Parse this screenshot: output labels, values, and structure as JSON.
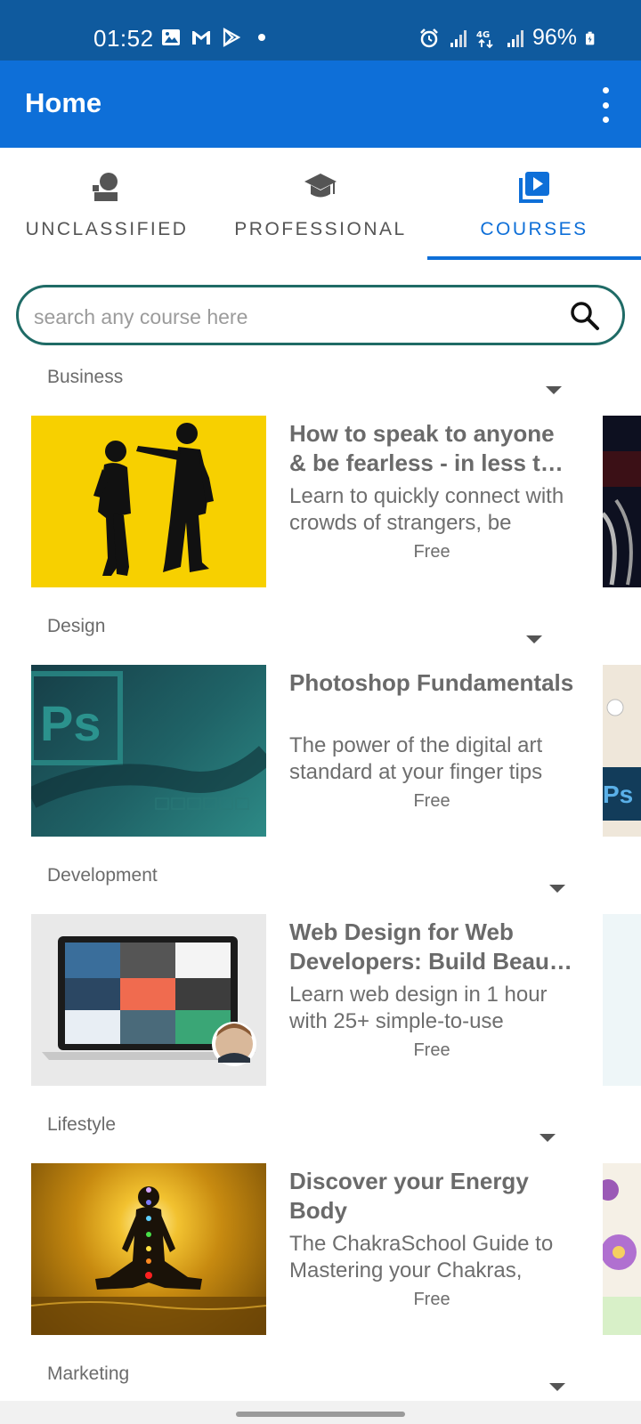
{
  "status_bar": {
    "time": "01:52",
    "battery": "96%",
    "left_icons": [
      "gallery-icon",
      "gmail-icon",
      "play-store-icon",
      "notification-dot"
    ],
    "right_icons": [
      "alarm-icon",
      "signal-icon",
      "4g-icon",
      "signal-icon",
      "battery-icon"
    ]
  },
  "app_bar": {
    "title": "Home",
    "menu_icon": "more-vert-icon",
    "color": "#0e6fd8"
  },
  "tabs": [
    {
      "label": "UNCLASSIFIED",
      "icon": "person-podium-icon",
      "active": false
    },
    {
      "label": "PROFESSIONAL",
      "icon": "graduation-cap-icon",
      "active": false
    },
    {
      "label": "COURSES",
      "icon": "video-library-icon",
      "active": true
    }
  ],
  "search": {
    "placeholder": "search any course here",
    "border_color": "#1f6b66"
  },
  "sections": [
    {
      "name": "Business",
      "course": {
        "title": "How to speak to anyone & be fearless - in less t…",
        "description": "Learn to quickly connect with crowds of strangers, be",
        "price": "Free"
      }
    },
    {
      "name": "Design",
      "course": {
        "title": "Photoshop Fundamentals",
        "description": "The power of the digital art standard at your finger tips",
        "price": "Free",
        "thumb_text": "Ps"
      }
    },
    {
      "name": "Development",
      "course": {
        "title": "Web Design for Web Developers: Build Beau…",
        "description": "Learn web design in 1 hour with 25+ simple-to-use",
        "price": "Free"
      }
    },
    {
      "name": "Lifestyle",
      "course": {
        "title": "Discover your Energy Body",
        "description": "The ChakraSchool Guide to Mastering your Chakras,",
        "price": "Free"
      }
    },
    {
      "name": "Marketing"
    }
  ]
}
